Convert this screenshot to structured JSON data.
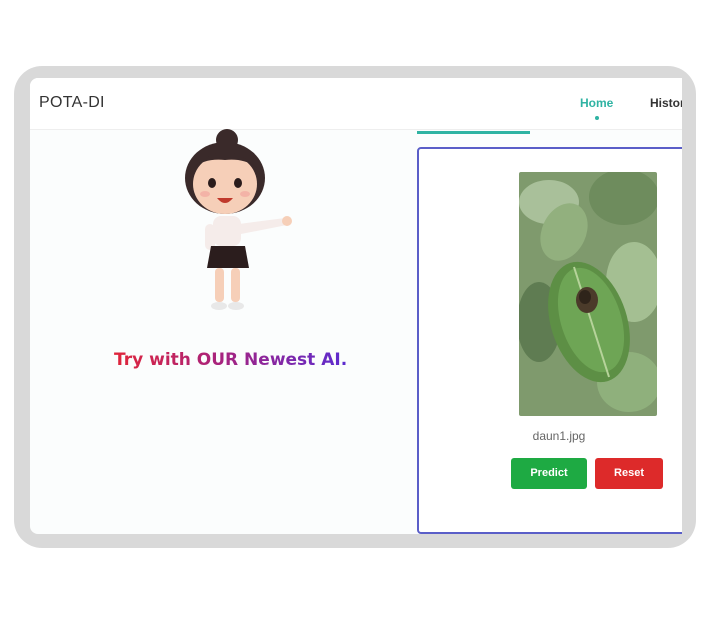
{
  "navbar": {
    "brand": "POTA-DI",
    "items": [
      {
        "label": "Home",
        "active": true
      },
      {
        "label": "Histor",
        "active": false
      }
    ]
  },
  "hero": {
    "tagline": "Try with OUR Newest AI.",
    "mascot_icon": "cartoon-girl-pointing"
  },
  "upload_panel": {
    "image_icon": "potato-leaf-photo",
    "file_name": "daun1.jpg",
    "predict_label": "Predict",
    "reset_label": "Reset"
  },
  "colors": {
    "accent": "#2fb3a3",
    "panel_border": "#5a5ec8",
    "predict": "#1eaa43",
    "reset": "#dd2a2a"
  }
}
